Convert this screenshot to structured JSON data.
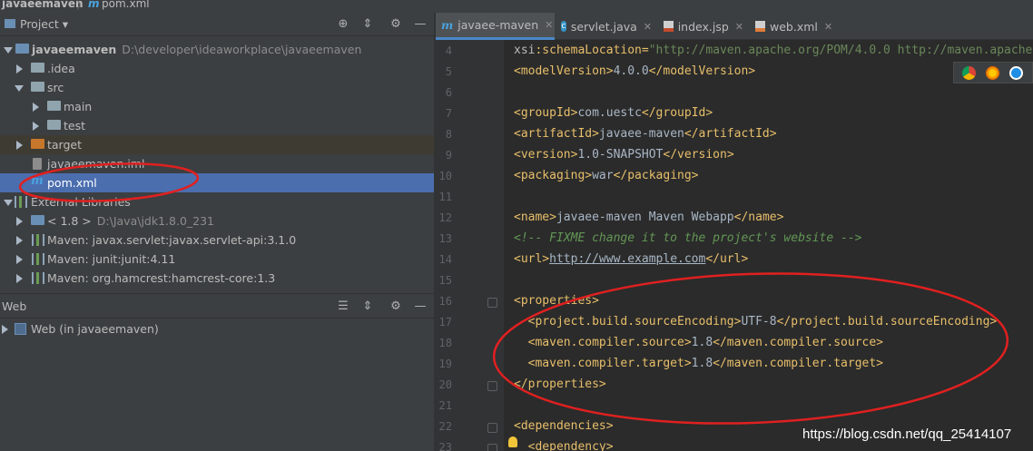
{
  "breadcrumb": {
    "project": "javaeemaven",
    "file": "pom.xml"
  },
  "project_panel": {
    "title": "Project",
    "dropdown": "▾"
  },
  "tree": [
    {
      "label": "javaeemaven",
      "path": "D:\\developer\\ideaworkplace\\javaeemaven"
    },
    {
      "label": ".idea"
    },
    {
      "label": "src"
    },
    {
      "label": "main"
    },
    {
      "label": "test"
    },
    {
      "label": "target"
    },
    {
      "label": "javaeemaven.iml"
    },
    {
      "label": "pom.xml"
    },
    {
      "label": "External Libraries"
    },
    {
      "label": "< 1.8 >",
      "path": "D:\\Java\\jdk1.8.0_231"
    },
    {
      "label": "Maven: javax.servlet:javax.servlet-api:3.1.0"
    },
    {
      "label": "Maven: junit:junit:4.11"
    },
    {
      "label": "Maven: org.hamcrest:hamcrest-core:1.3"
    }
  ],
  "web_panel": {
    "title": "Web",
    "item": "Web (in javaeemaven)"
  },
  "tabs": [
    {
      "label": "javaee-maven",
      "icon": "maven-icon",
      "active": true
    },
    {
      "label": "servlet.java",
      "icon": "class-icon"
    },
    {
      "label": "index.jsp",
      "icon": "jsp-icon"
    },
    {
      "label": "web.xml",
      "icon": "xml-icon"
    }
  ],
  "editor": {
    "line_numbers": [
      "4",
      "5",
      "6",
      "7",
      "8",
      "9",
      "10",
      "11",
      "12",
      "13",
      "14",
      "15",
      "16",
      "17",
      "18",
      "19",
      "20",
      "21",
      "22",
      "23"
    ],
    "lines": [
      {
        "p1": "xsi",
        "p2": ":schemaLocation=",
        "p3": "\"http://maven.apache.org/POM/4.0.0 http://maven.apache"
      },
      {
        "t1": "<modelVersion>",
        "v": "4.0.0",
        "t2": "</modelVersion>"
      },
      {},
      {
        "t1": "<groupId>",
        "v": "com.uestc",
        "t2": "</groupId>"
      },
      {
        "t1": "<artifactId>",
        "v": "javaee-maven",
        "t2": "</artifactId>"
      },
      {
        "t1": "<version>",
        "v": "1.0-SNAPSHOT",
        "t2": "</version>"
      },
      {
        "t1": "<packaging>",
        "v": "war",
        "t2": "</packaging>"
      },
      {},
      {
        "t1": "<name>",
        "v": "javaee-maven Maven Webapp",
        "t2": "</name>"
      },
      {
        "comment": "<!-- FIXME change it to the project's website -->"
      },
      {
        "t1": "<url>",
        "v": "http://www.example.com",
        "t2": "</url>"
      },
      {},
      {
        "t1": "<properties>"
      },
      {
        "t1": "  <project.build.sourceEncoding>",
        "v": "UTF-8",
        "t2": "</project.build.sourceEncoding>"
      },
      {
        "t1": "  <maven.compiler.source>",
        "v": "1.8",
        "t2": "</maven.compiler.source>"
      },
      {
        "t1": "  <maven.compiler.target>",
        "v": "1.8",
        "t2": "</maven.compiler.target>"
      },
      {
        "t1": "</properties>"
      },
      {},
      {
        "t1": "<dependencies>"
      },
      {
        "t1": "  <dependency>"
      }
    ]
  },
  "watermark": "https://blog.csdn.net/qq_25414107",
  "colors": {
    "annotation": "#e02020",
    "selection": "#4b6eaf",
    "accent": "#4a88c7"
  }
}
